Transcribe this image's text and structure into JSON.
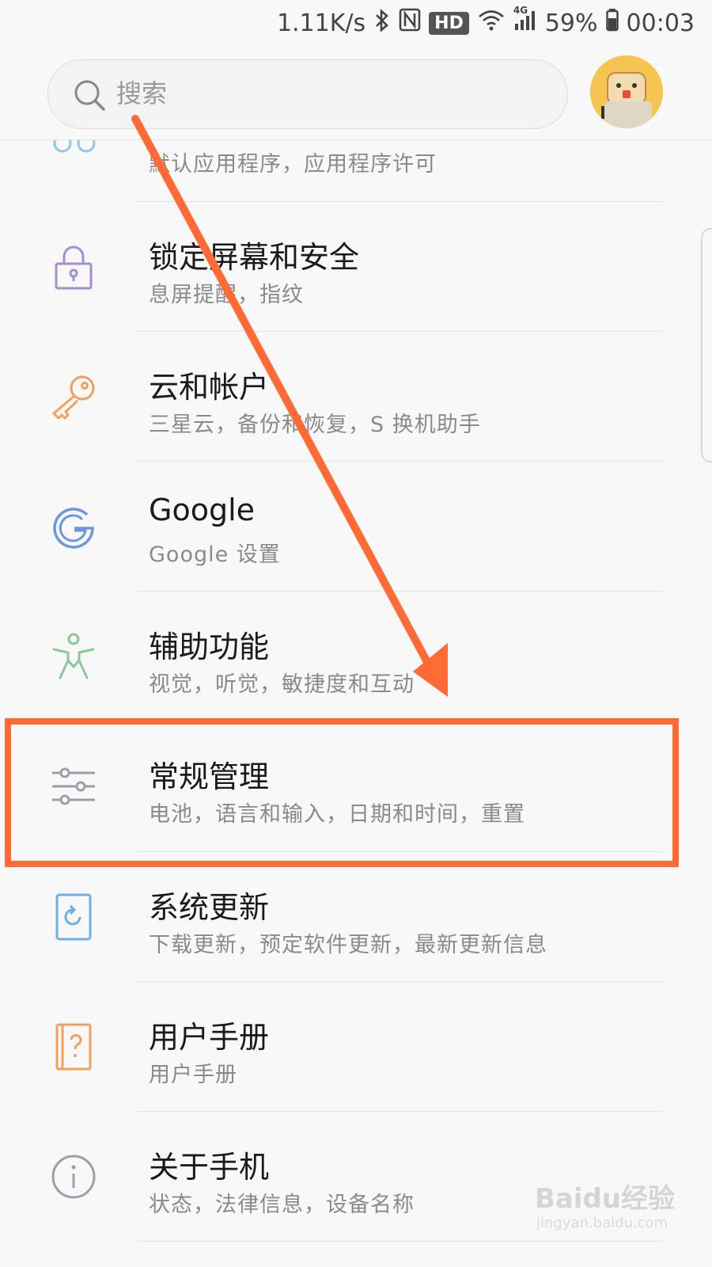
{
  "status_bar": {
    "net_speed": "1.11K/s",
    "hd": "HD",
    "network": "4G",
    "battery": "59%",
    "time": "00:03"
  },
  "search": {
    "placeholder": "搜索"
  },
  "partial_item": {
    "subtitle": "默认应用程序，应用程序许可"
  },
  "items": [
    {
      "title": "锁定屏幕和安全",
      "subtitle": "息屏提醒，指纹",
      "icon": "lock-icon"
    },
    {
      "title": "云和帐户",
      "subtitle": "三星云，备份和恢复，S 换机助手",
      "icon": "key-icon"
    },
    {
      "title": "Google",
      "subtitle": "Google 设置",
      "icon": "google-icon"
    },
    {
      "title": "辅助功能",
      "subtitle": "视觉，听觉，敏捷度和互动",
      "icon": "accessibility-icon"
    },
    {
      "title": "常规管理",
      "subtitle": "电池，语言和输入，日期和时间，重置",
      "icon": "sliders-icon"
    },
    {
      "title": "系统更新",
      "subtitle": "下载更新，预定软件更新，最新更新信息",
      "icon": "system-update-icon"
    },
    {
      "title": "用户手册",
      "subtitle": "用户手册",
      "icon": "user-manual-icon"
    },
    {
      "title": "关于手机",
      "subtitle": "状态，法律信息，设备名称",
      "icon": "info-icon"
    }
  ],
  "colors": {
    "highlight": "#ff6a35",
    "arrow": "#ff6a35"
  },
  "watermark": {
    "brand": "Baidu经验",
    "url": "jingyan.baidu.com"
  }
}
